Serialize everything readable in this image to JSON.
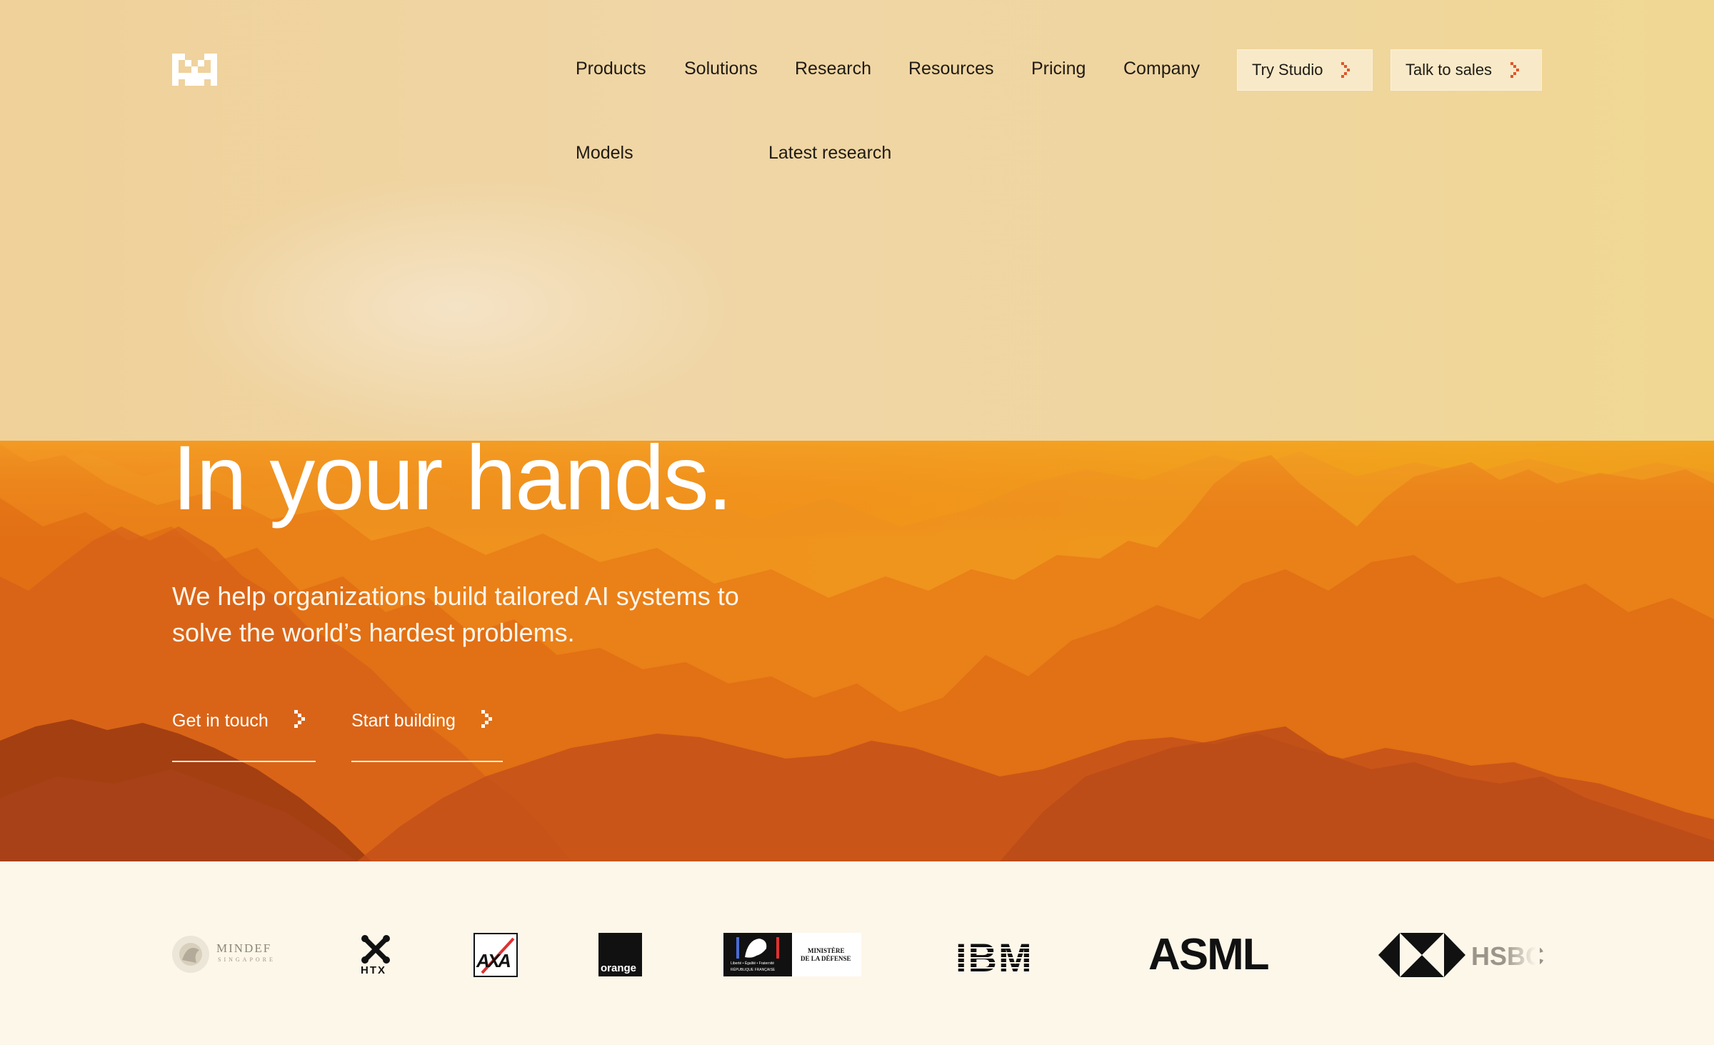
{
  "header": {
    "logo_icon": "brand-m-logo-icon",
    "nav": [
      "Products",
      "Solutions",
      "Research",
      "Resources",
      "Pricing",
      "Company"
    ],
    "cta_primary": "Try Studio",
    "cta_secondary": "Talk to sales",
    "submenu": [
      "Models",
      "Latest research"
    ],
    "accent": "#e0552b"
  },
  "hero": {
    "title": "In your hands.",
    "subtitle": "We help organizations build tailored AI systems to solve the world’s hardest problems.",
    "buttons": [
      "Get in touch",
      "Start building"
    ]
  },
  "clients": {
    "mindef": {
      "name": "MINDEF",
      "sub": "SINGAPORE"
    },
    "htx": "HTX",
    "axa": "AXA",
    "orange": "orange",
    "ministere": {
      "line1": "MINISTÈRE",
      "line2": "DE LA DÉFENSE",
      "motto": "Liberté • Égalité • Fraternité",
      "republic": "RÉPUBLIQUE FRANÇAISE"
    },
    "ibm": "IBM",
    "asml": "ASML",
    "hsbc": "HSBC"
  }
}
